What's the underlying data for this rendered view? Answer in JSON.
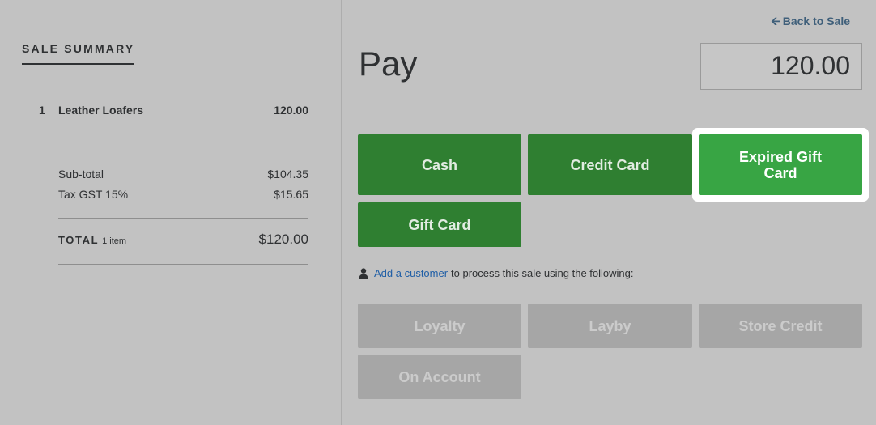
{
  "summary": {
    "title": "SALE SUMMARY",
    "items": [
      {
        "qty": "1",
        "name": "Leather Loafers",
        "price": "120.00"
      }
    ],
    "subtotal_label": "Sub-total",
    "subtotal_value": "$104.35",
    "tax_label": "Tax GST 15%",
    "tax_value": "$15.65",
    "total_label": "TOTAL",
    "total_count": "1 item",
    "total_value": "$120.00"
  },
  "header": {
    "back_label": "Back to Sale",
    "pay_title": "Pay",
    "amount": "120.00"
  },
  "payment_methods": {
    "cash": "Cash",
    "credit_card": "Credit Card",
    "expired_gift_card": "Expired Gift Card",
    "gift_card": "Gift Card"
  },
  "customer_prompt": {
    "link": "Add a customer",
    "text": "to process this sale using the following:"
  },
  "customer_methods": {
    "loyalty": "Loyalty",
    "layby": "Layby",
    "store_credit": "Store Credit",
    "on_account": "On Account"
  },
  "colors": {
    "payment_button": "#2f7f31",
    "highlighted_button": "#38a544",
    "disabled_button": "#a6a6a6",
    "link": "#1f5ea6"
  }
}
